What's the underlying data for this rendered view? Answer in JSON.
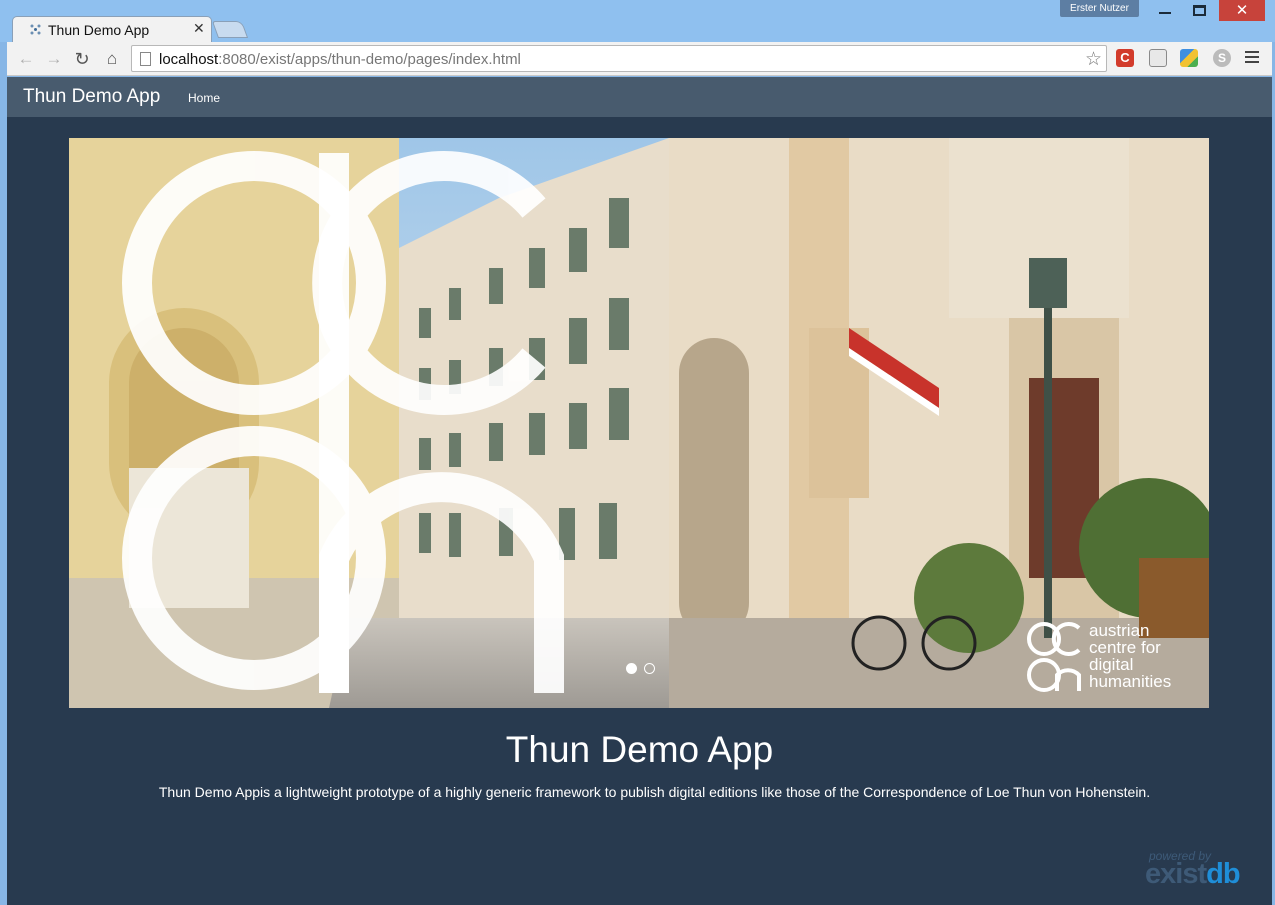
{
  "window": {
    "user_badge": "Erster Nutzer",
    "minimize_icon": "minimize-icon",
    "maximize_icon": "maximize-icon",
    "close_glyph": "✕"
  },
  "tab": {
    "title": "Thun Demo App",
    "close_glyph": "✕"
  },
  "toolbar": {
    "back_glyph": "←",
    "forward_glyph": "→",
    "reload_glyph": "↻",
    "home_glyph": "⌂",
    "url_host": "localhost",
    "url_path": ":8080/exist/apps/thun-demo/pages/index.html",
    "star_glyph": "☆",
    "ext_c_label": "C",
    "ext_skype_label": "S"
  },
  "app": {
    "brand": "Thun Demo App",
    "nav_home": "Home"
  },
  "carousel": {
    "logo_text_lines": [
      "austrian",
      "centre for",
      "digital",
      "humanities"
    ],
    "slide_count": 2,
    "active_slide": 1
  },
  "hero": {
    "title": "Thun Demo App",
    "description": "Thun Demo Appis a lightweight prototype of a highly generic framework to publish digital editions like those of the Correspondence of Loe Thun von Hohenstein."
  },
  "footer": {
    "powered_by": "powered by",
    "exist_part": "exist",
    "db_part": "db"
  },
  "colors": {
    "page_bg": "#283a4f",
    "navbar_bg": "#485b6e",
    "exist_blue": "#1f8ed8"
  }
}
